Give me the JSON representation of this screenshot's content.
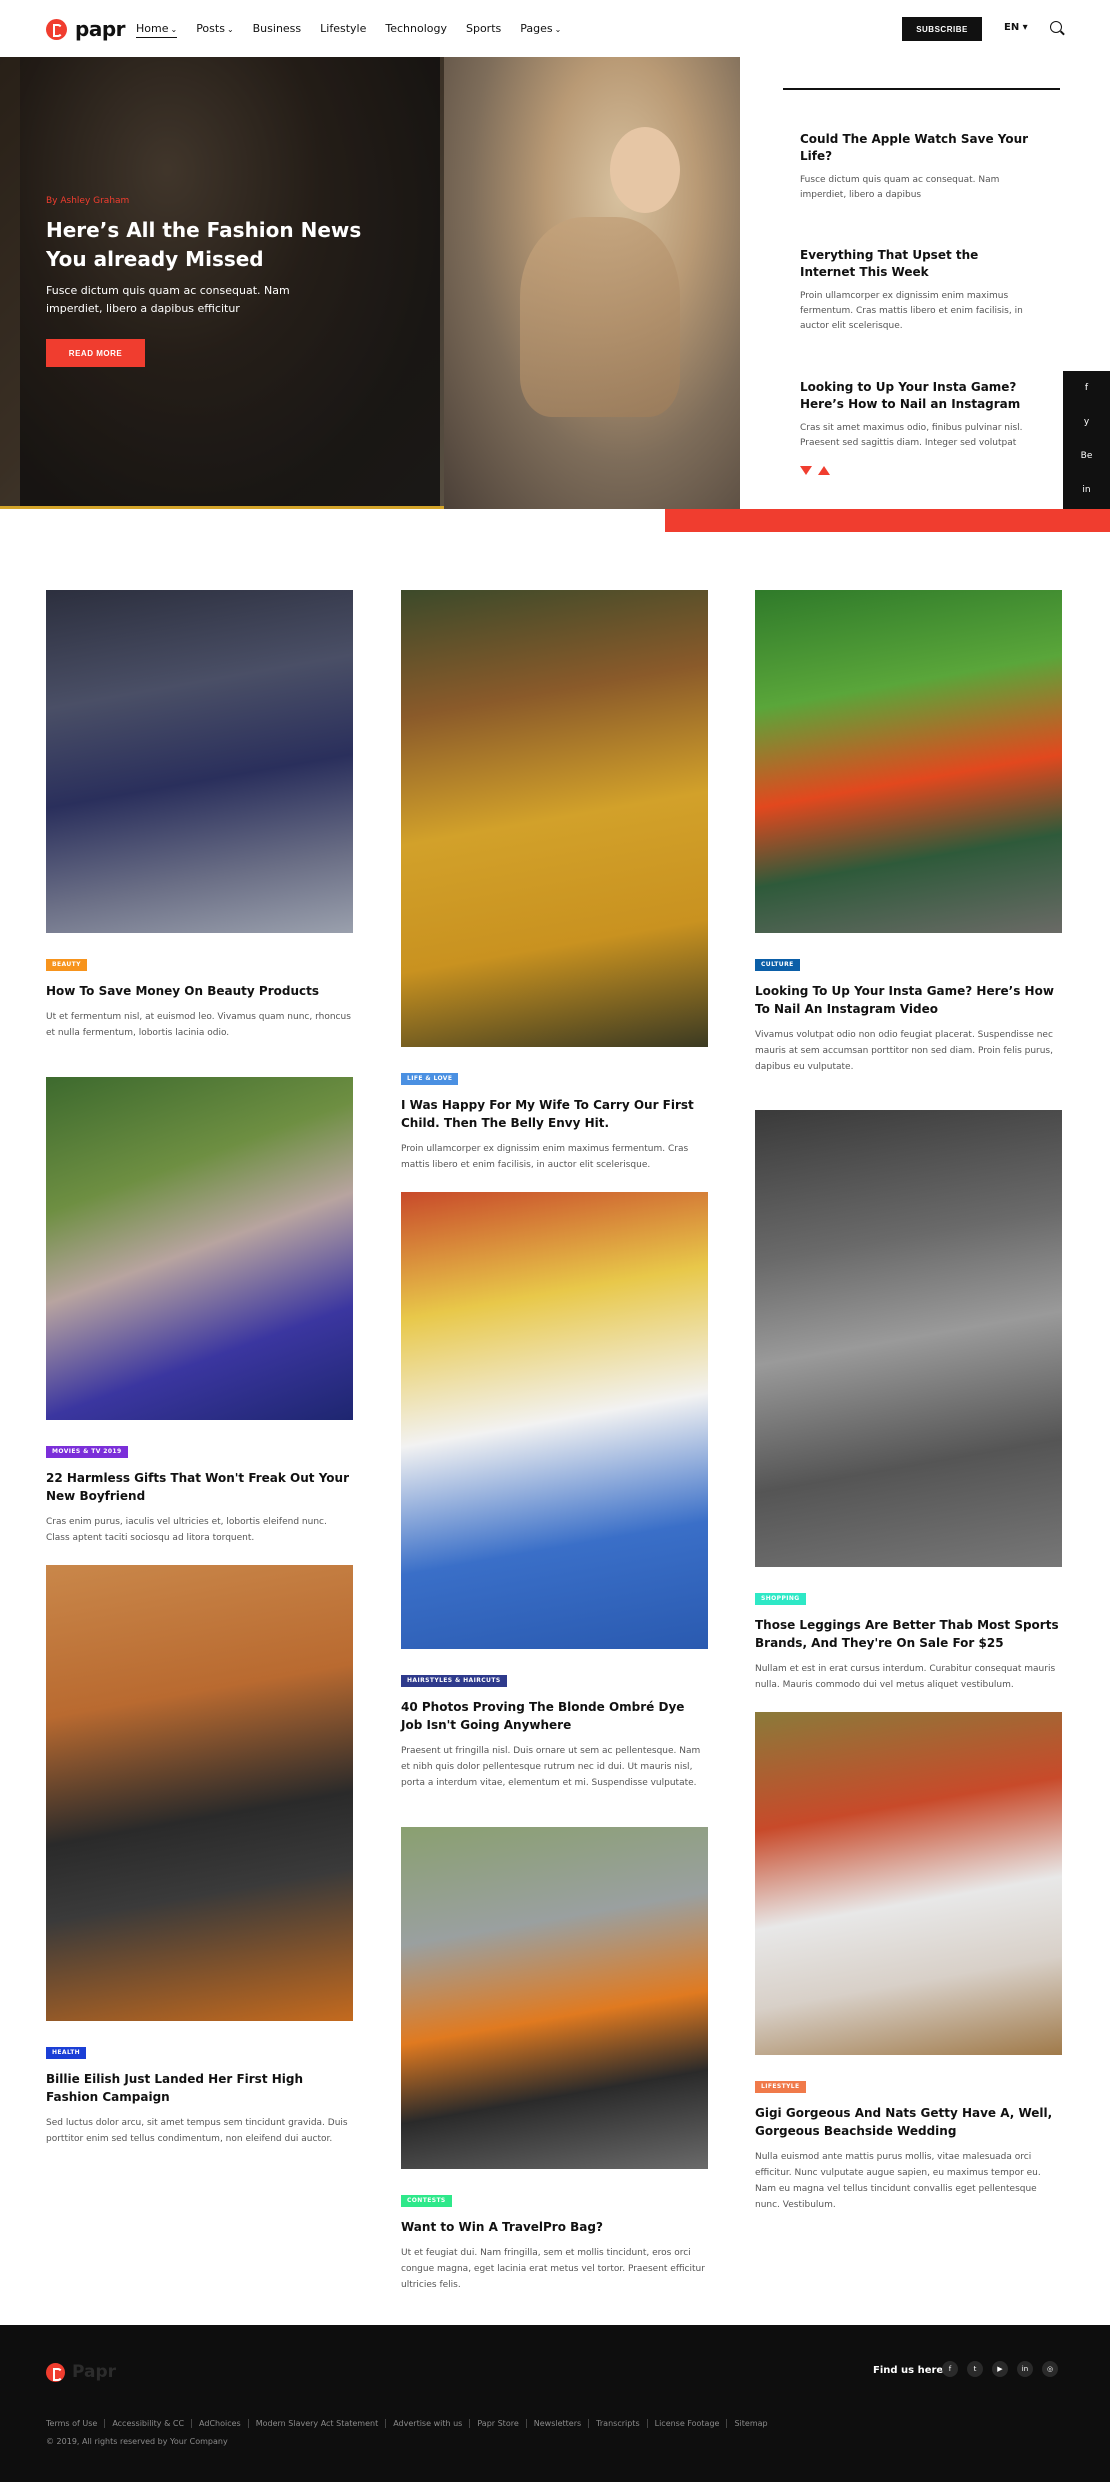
{
  "header": {
    "logo": "papr",
    "nav": [
      {
        "label": "Home",
        "caret": true,
        "active": true
      },
      {
        "label": "Posts",
        "caret": true
      },
      {
        "label": "Business",
        "caret": false
      },
      {
        "label": "Lifestyle",
        "caret": false
      },
      {
        "label": "Technology",
        "caret": false
      },
      {
        "label": "Sports",
        "caret": false
      },
      {
        "label": "Pages",
        "caret": true
      }
    ],
    "subscribe": "SUBSCRIBE",
    "language": "EN ▾",
    "search_icon": "search-icon"
  },
  "hero": {
    "author": "By Ashley Graham",
    "title": "Here’s All the Fashion News You already Missed",
    "description": "Fusce dictum quis quam ac consequat. Nam imperdiet, libero a dapibus efficitur",
    "button": "READ MORE"
  },
  "side_list": [
    {
      "title": "Could The Apple Watch Save Your Life?",
      "text": "Fusce dictum quis quam ac consequat. Nam imperdiet, libero a dapibus"
    },
    {
      "title": "Everything That Upset the Internet This Week",
      "text": "Proin ullamcorper ex dignissim enim maximus fermentum. Cras mattis libero et enim facilisis, in auctor elit scelerisque."
    },
    {
      "title": "Looking to Up Your Insta Game? Here’s How to Nail an Instagram",
      "text": "Cras sit amet maximus odio, finibus pulvinar nisl. Praesent sed sagittis diam. Integer sed volutpat"
    }
  ],
  "social_bar": [
    "f",
    "y",
    "Be",
    "in"
  ],
  "cards": [
    {
      "badge": "BEAUTY",
      "badge_color": "#f7941d",
      "title": "How To Save Money On Beauty Products",
      "text": "Ut et fermentum nisl, at euismod leo. Vivamus quam nunc, rhoncus et nulla fermentum, lobortis lacinia odio."
    },
    {
      "badge": "MOVIES & TV 2019",
      "badge_color": "#7b2fd9",
      "title": "22 Harmless Gifts That Won't Freak Out Your New Boyfriend",
      "text": "Cras enim purus, iaculis vel ultricies et, lobortis eleifend nunc. Class aptent taciti sociosqu ad litora torquent."
    },
    {
      "badge": "HEALTH",
      "badge_color": "#1b3fd6",
      "title": "Billie Eilish Just Landed Her First High Fashion Campaign",
      "text": "Sed luctus dolor arcu, sit amet tempus sem tincidunt gravida. Duis porttitor enim sed tellus condimentum, non eleifend dui auctor."
    },
    {
      "badge": "LIFE & LOVE",
      "badge_color": "#4a90e2",
      "title": "I Was Happy For My Wife To Carry Our First Child. Then The Belly Envy Hit.",
      "text": "Proin ullamcorper ex dignissim enim maximus fermentum. Cras mattis libero et enim facilisis, in auctor elit scelerisque."
    },
    {
      "badge": "HAIRSTYLES & HAIRCUTS",
      "badge_color": "#2e3a8c",
      "title": "40 Photos Proving The Blonde Ombré Dye Job Isn't Going Anywhere",
      "text": "Praesent ut fringilla nisl. Duis ornare ut sem ac pellentesque. Nam et nibh quis dolor pellentesque rutrum nec id dui. Ut mauris nisl, porta a interdum vitae, elementum et mi. Suspendisse vulputate."
    },
    {
      "badge": "CONTESTS",
      "badge_color": "#2ee88a",
      "title": "Want to Win A TravelPro Bag?",
      "text": "Ut et feugiat dui. Nam fringilla, sem et mollis tincidunt, eros orci congue magna, eget lacinia erat metus vel tortor. Praesent efficitur ultricies felis."
    },
    {
      "badge": "CULTURE",
      "badge_color": "#0b5fa8",
      "title": "Looking To Up Your Insta Game? Here’s How To Nail An Instagram Video",
      "text": "Vivamus volutpat odio non odio feugiat placerat. Suspendisse nec mauris at sem accumsan porttitor non sed diam. Proin felis purus, dapibus eu vulputate."
    },
    {
      "badge": "SHOPPING",
      "badge_color": "#2ee8c6",
      "title": "Those Leggings Are Better Thab Most Sports Brands, And They're On Sale For $25",
      "text": "Nullam et est in erat cursus interdum. Curabitur consequat mauris nulla. Mauris commodo dui vel metus aliquet vestibulum."
    },
    {
      "badge": "LIFESTYLE",
      "badge_color": "#f07a4a",
      "title": "Gigi Gorgeous And Nats Getty Have A, Well, Gorgeous Beachside Wedding",
      "text": "Nulla euismod ante mattis purus mollis, vitae malesuada orci efficitur. Nunc vulputate augue sapien, eu maximus tempor eu. Nam eu magna vel tellus tincidunt convallis eget pellentesque nunc. Vestibulum."
    }
  ],
  "footer": {
    "logo": "Papr",
    "find_us": "Find us here",
    "socials": [
      "f",
      "t",
      "▶",
      "in",
      "◎"
    ],
    "links": [
      "Terms of Use",
      "Accessibility & CC",
      "AdChoices",
      "Modern Slavery Act Statement",
      "Advertise with us",
      "Papr Store",
      "Newsletters",
      "Transcripts",
      "License Footage",
      "Sitemap"
    ],
    "copyright": "© 2019, All rights reserved by Your Company"
  }
}
